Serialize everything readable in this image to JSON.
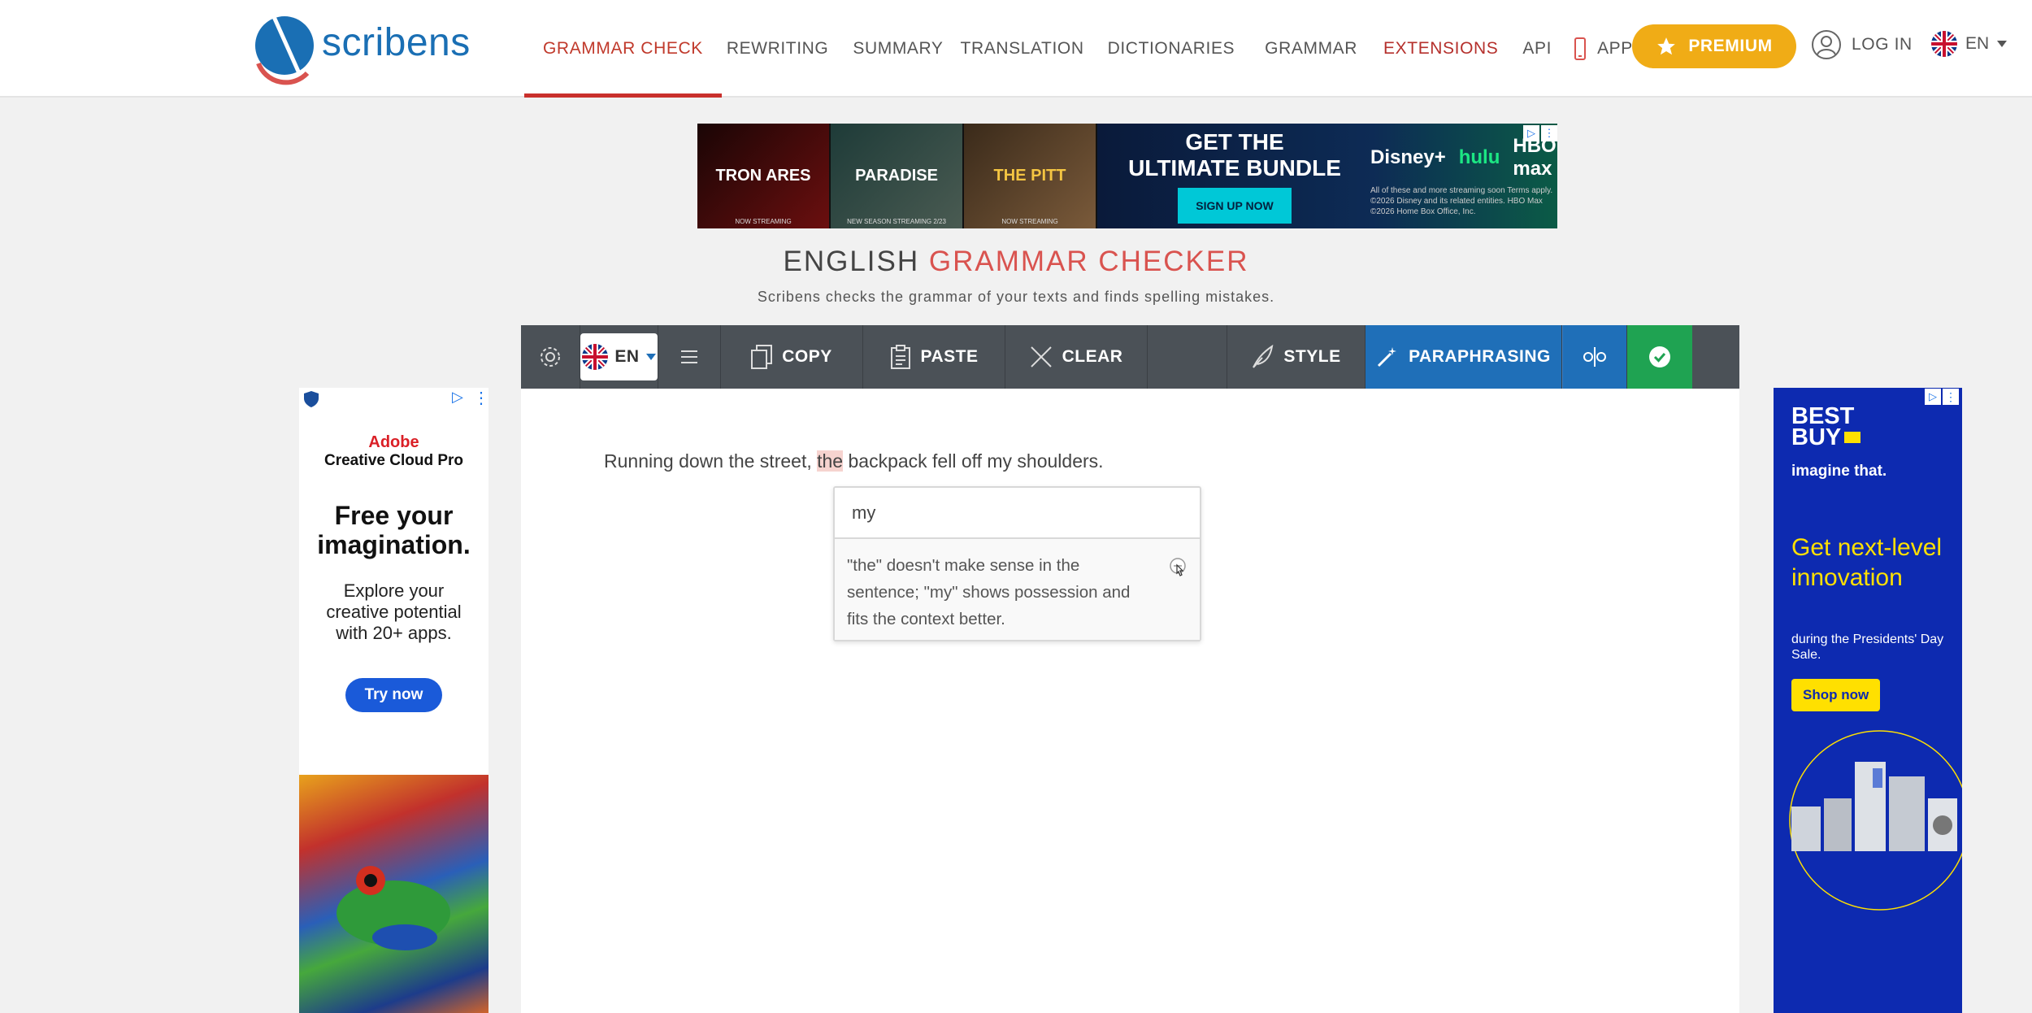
{
  "header": {
    "logo_text": "scribens",
    "nav": [
      {
        "label": "GRAMMAR CHECK",
        "active": true
      },
      {
        "label": "REWRITING"
      },
      {
        "label": "SUMMARY"
      },
      {
        "label": "TRANSLATION"
      },
      {
        "label": "DICTIONARIES"
      },
      {
        "label": "GRAMMAR"
      },
      {
        "label": "EXTENSIONS"
      },
      {
        "label": "API"
      },
      {
        "label": "APP"
      }
    ],
    "premium_label": "PREMIUM",
    "login_label": "LOG IN",
    "language": "EN"
  },
  "top_ad": {
    "tiles": [
      "TRON ARES",
      "PARADISE",
      "THE PITT"
    ],
    "tile_captions": [
      "NOW STREAMING",
      "NEW SEASON STREAMING 2/23",
      "NOW STREAMING"
    ],
    "headline_1": "GET THE",
    "headline_2": "ULTIMATE BUNDLE",
    "cta": "SIGN UP NOW",
    "brands": [
      "Disney+",
      "hulu",
      "HBO max"
    ],
    "terms": "All of these and more streaming soon Terms apply. ©2026 Disney and its related entities. HBO Max ©2026 Home Box Office, Inc."
  },
  "page": {
    "title_part1": "ENGLISH",
    "title_part2": "GRAMMAR CHECKER",
    "subtitle": "Scribens checks the grammar of your texts and finds spelling mistakes."
  },
  "toolbar": {
    "language": "EN",
    "copy": "COPY",
    "paste": "PASTE",
    "clear": "CLEAR",
    "style": "STYLE",
    "paraphrasing": "PARAPHRASING"
  },
  "editor": {
    "text_before": "Running down the street, ",
    "error_word": "the",
    "text_after": " backpack fell off my shoulders."
  },
  "popup": {
    "suggestion": "my",
    "explanation": "\"the\" doesn't make sense in the sentence; \"my\" shows possession and fits the context better."
  },
  "left_ad": {
    "brand": "Adobe",
    "product": "Creative Cloud Pro",
    "headline": "Free your imagination.",
    "body": "Explore your creative potential with 20+ apps.",
    "cta": "Try now"
  },
  "right_ad": {
    "brand_line1": "BEST",
    "brand_line2": "BUY",
    "tagline": "imagine that.",
    "headline": "Get next-level innovation",
    "body": "during the Presidents' Day Sale.",
    "cta": "Shop now"
  },
  "colors": {
    "brand_blue": "#1a6fb4",
    "accent_red": "#d9534f",
    "premium": "#f0ac16",
    "toolbar": "#4b5157",
    "paraphrasing": "#1f6fb8",
    "check": "#1fa352"
  }
}
